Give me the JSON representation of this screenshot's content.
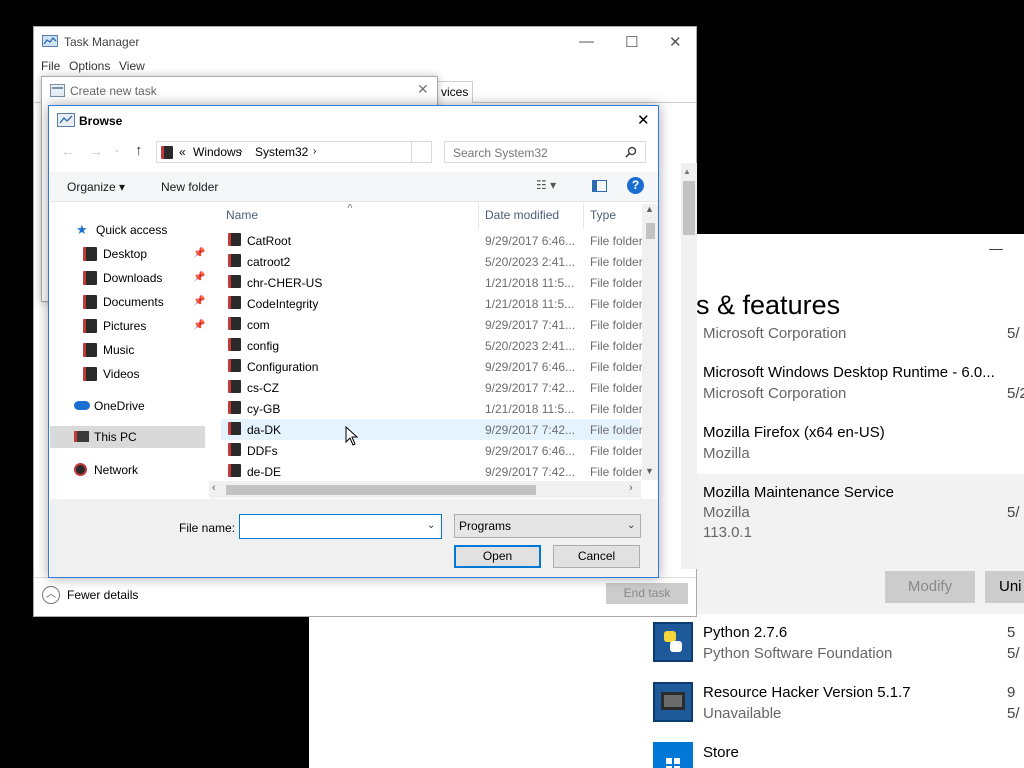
{
  "apps": {
    "minimize_glyph": "—",
    "heading": "ps & features",
    "entries": [
      {
        "name": "",
        "publisher": "Microsoft Corporation",
        "extra": "",
        "date": "5/"
      },
      {
        "name": "Microsoft Windows Desktop Runtime - 6.0...",
        "publisher": "Microsoft Corporation",
        "extra": "",
        "date": "5/2"
      },
      {
        "name": "Mozilla Firefox (x64 en-US)",
        "publisher": "Mozilla",
        "extra": "",
        "date": ""
      },
      {
        "name": "Mozilla Maintenance Service",
        "publisher": "Mozilla",
        "extra": "113.0.1",
        "date": "5/"
      },
      {
        "name": "Python 2.7.6",
        "publisher": "Python Software Foundation",
        "extra": "",
        "date": "5/"
      },
      {
        "name": "Resource Hacker Version 5.1.7",
        "publisher": "Unavailable",
        "extra": "",
        "date": "5/"
      },
      {
        "name": "Store",
        "publisher": "",
        "extra": "",
        "date": ""
      }
    ],
    "modify_label": "Modify",
    "uninstall_label": "Uni",
    "right_date_python": "5",
    "right_date_reshacker": "9"
  },
  "task_manager": {
    "title": "Task Manager",
    "menu": [
      "File",
      "Options",
      "View"
    ],
    "tab_partial": "vices",
    "fewer_details": "Fewer details",
    "end_task": "End task"
  },
  "create_task": {
    "title": "Create new task"
  },
  "browse": {
    "title": "Browse",
    "address": [
      "«",
      "Windows",
      "System32"
    ],
    "search_placeholder": "Search System32",
    "organize": "Organize ▾",
    "new_folder": "New folder",
    "nav": {
      "quick_access": "Quick access",
      "desktop": "Desktop",
      "downloads": "Downloads",
      "documents": "Documents",
      "pictures": "Pictures",
      "music": "Music",
      "videos": "Videos",
      "onedrive": "OneDrive",
      "this_pc": "This PC",
      "network": "Network"
    },
    "columns": {
      "name": "Name",
      "date": "Date modified",
      "type": "Type"
    },
    "files": [
      {
        "name": "CatRoot",
        "date": "9/29/2017 6:46...",
        "type": "File folder"
      },
      {
        "name": "catroot2",
        "date": "5/20/2023 2:41...",
        "type": "File folder"
      },
      {
        "name": "chr-CHER-US",
        "date": "1/21/2018 11:5...",
        "type": "File folder"
      },
      {
        "name": "CodeIntegrity",
        "date": "1/21/2018 11:5...",
        "type": "File folder"
      },
      {
        "name": "com",
        "date": "9/29/2017 7:41...",
        "type": "File folder"
      },
      {
        "name": "config",
        "date": "5/20/2023 2:41...",
        "type": "File folder"
      },
      {
        "name": "Configuration",
        "date": "9/29/2017 6:46...",
        "type": "File folder"
      },
      {
        "name": "cs-CZ",
        "date": "9/29/2017 7:42...",
        "type": "File folder"
      },
      {
        "name": "cy-GB",
        "date": "1/21/2018 11:5...",
        "type": "File folder"
      },
      {
        "name": "da-DK",
        "date": "9/29/2017 7:42...",
        "type": "File folder"
      },
      {
        "name": "DDFs",
        "date": "9/29/2017 6:46...",
        "type": "File folder"
      },
      {
        "name": "de-DE",
        "date": "9/29/2017 7:42...",
        "type": "File folder"
      }
    ],
    "file_name_label": "File name:",
    "file_name_value": "",
    "file_type": "Programs",
    "open_label": "Open",
    "cancel_label": "Cancel"
  },
  "colors": {
    "accent": "#0078d7",
    "hover_row": "#e5f3ff",
    "selected_nav": "#d9d9d9"
  }
}
